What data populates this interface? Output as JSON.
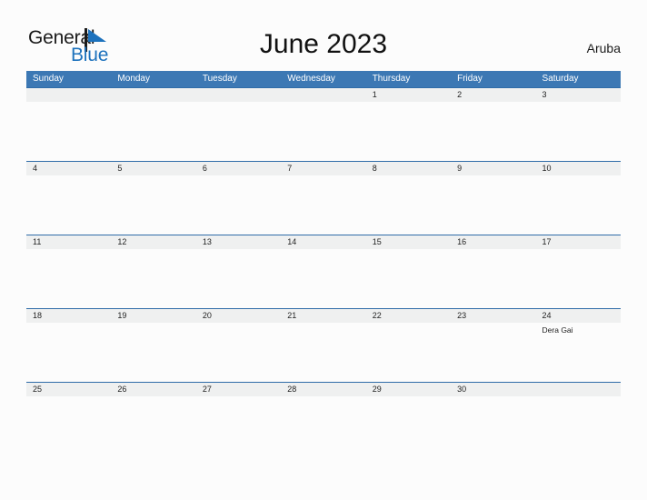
{
  "logo": {
    "word_top": "General",
    "word_bottom": "Blue",
    "flag_icon": "blue-flag-triangle-icon",
    "blue": "#1d72bd"
  },
  "header": {
    "title": "June 2023",
    "region": "Aruba"
  },
  "theme": {
    "header_blue": "#3c78b4",
    "rule_blue": "#2f6ca8",
    "date_band_gray": "#eff0f0",
    "page_background": "#fcfcfc",
    "text_dark": "#222222"
  },
  "calendar": {
    "day_headers": [
      "Sunday",
      "Monday",
      "Tuesday",
      "Wednesday",
      "Thursday",
      "Friday",
      "Saturday"
    ],
    "weeks": [
      {
        "days": [
          {
            "date": "",
            "events": []
          },
          {
            "date": "",
            "events": []
          },
          {
            "date": "",
            "events": []
          },
          {
            "date": "",
            "events": []
          },
          {
            "date": "1",
            "events": []
          },
          {
            "date": "2",
            "events": []
          },
          {
            "date": "3",
            "events": []
          }
        ]
      },
      {
        "days": [
          {
            "date": "4",
            "events": []
          },
          {
            "date": "5",
            "events": []
          },
          {
            "date": "6",
            "events": []
          },
          {
            "date": "7",
            "events": []
          },
          {
            "date": "8",
            "events": []
          },
          {
            "date": "9",
            "events": []
          },
          {
            "date": "10",
            "events": []
          }
        ]
      },
      {
        "days": [
          {
            "date": "11",
            "events": []
          },
          {
            "date": "12",
            "events": []
          },
          {
            "date": "13",
            "events": []
          },
          {
            "date": "14",
            "events": []
          },
          {
            "date": "15",
            "events": []
          },
          {
            "date": "16",
            "events": []
          },
          {
            "date": "17",
            "events": []
          }
        ]
      },
      {
        "days": [
          {
            "date": "18",
            "events": []
          },
          {
            "date": "19",
            "events": []
          },
          {
            "date": "20",
            "events": []
          },
          {
            "date": "21",
            "events": []
          },
          {
            "date": "22",
            "events": []
          },
          {
            "date": "23",
            "events": []
          },
          {
            "date": "24",
            "events": [
              "Dera Gai"
            ]
          }
        ]
      },
      {
        "days": [
          {
            "date": "25",
            "events": []
          },
          {
            "date": "26",
            "events": []
          },
          {
            "date": "27",
            "events": []
          },
          {
            "date": "28",
            "events": []
          },
          {
            "date": "29",
            "events": []
          },
          {
            "date": "30",
            "events": []
          },
          {
            "date": "",
            "events": []
          }
        ]
      }
    ]
  }
}
